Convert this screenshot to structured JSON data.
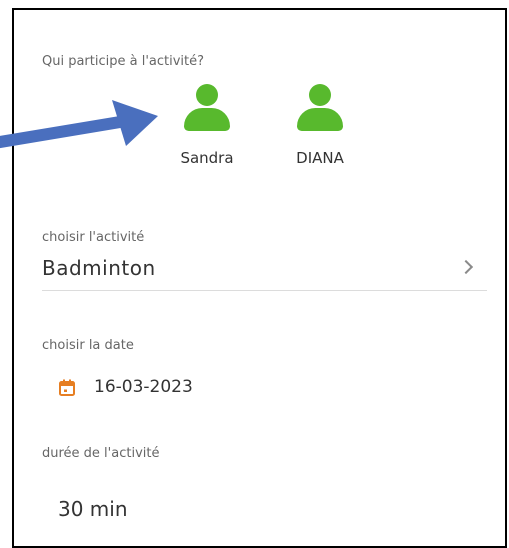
{
  "participants": {
    "label": "Qui participe à l'activité?",
    "people": [
      {
        "name": "Sandra",
        "icon": "person-icon"
      },
      {
        "name": "DIANA",
        "icon": "person-icon"
      }
    ]
  },
  "activity": {
    "label": "choisir l'activité",
    "value": "Badminton",
    "icon": "chevron-right-icon"
  },
  "date": {
    "label": "choisir la date",
    "value": "16-03-2023",
    "icon": "calendar-icon"
  },
  "duration": {
    "label": "durée de l'activité",
    "value": "30 min"
  },
  "colors": {
    "accent_green": "#58b92d",
    "calendar_orange": "#e67e22",
    "arrow_blue": "#4a6fbe"
  }
}
